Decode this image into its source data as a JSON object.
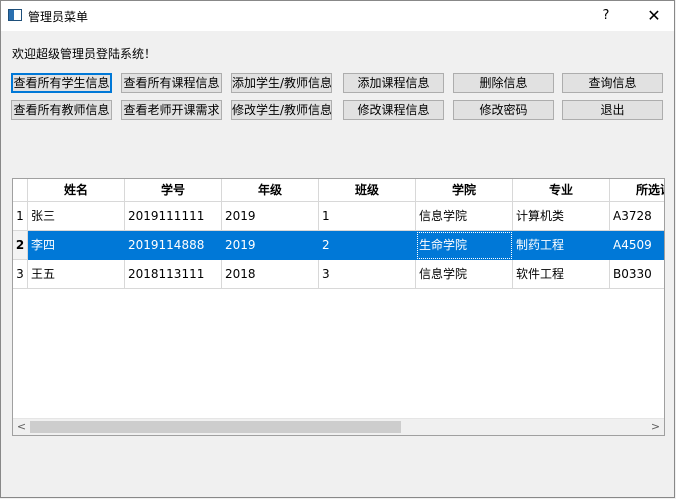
{
  "window": {
    "title": "管理员菜单",
    "help": "?",
    "close": "✕"
  },
  "welcome": "欢迎超级管理员登陆系统！",
  "buttons_row1": [
    "查看所有学生信息",
    "查看所有课程信息",
    "添加学生/教师信息",
    "添加课程信息",
    "删除信息",
    "查询信息"
  ],
  "buttons_row2": [
    "查看所有教师信息",
    "查看老师开课需求",
    "修改学生/教师信息",
    "修改课程信息",
    "修改密码",
    "退出"
  ],
  "table": {
    "columns": [
      "姓名",
      "学号",
      "年级",
      "班级",
      "学院",
      "专业",
      "所选课"
    ],
    "row_numbers": [
      "1",
      "2",
      "3"
    ],
    "rows": [
      [
        "张三",
        "2019111111",
        "2019",
        "1",
        "信息学院",
        "计算机类",
        "A3728"
      ],
      [
        "李四",
        "2019114888",
        "2019",
        "2",
        "生命学院",
        "制药工程",
        "A4509"
      ],
      [
        "王五",
        "2018113111",
        "2018",
        "3",
        "信息学院",
        "软件工程",
        "B0330"
      ]
    ],
    "selected_row": 2,
    "scroll_left": "<",
    "scroll_right": ">"
  },
  "colors": {
    "selection": "#0078d7",
    "focus_border": "#0078d7"
  }
}
